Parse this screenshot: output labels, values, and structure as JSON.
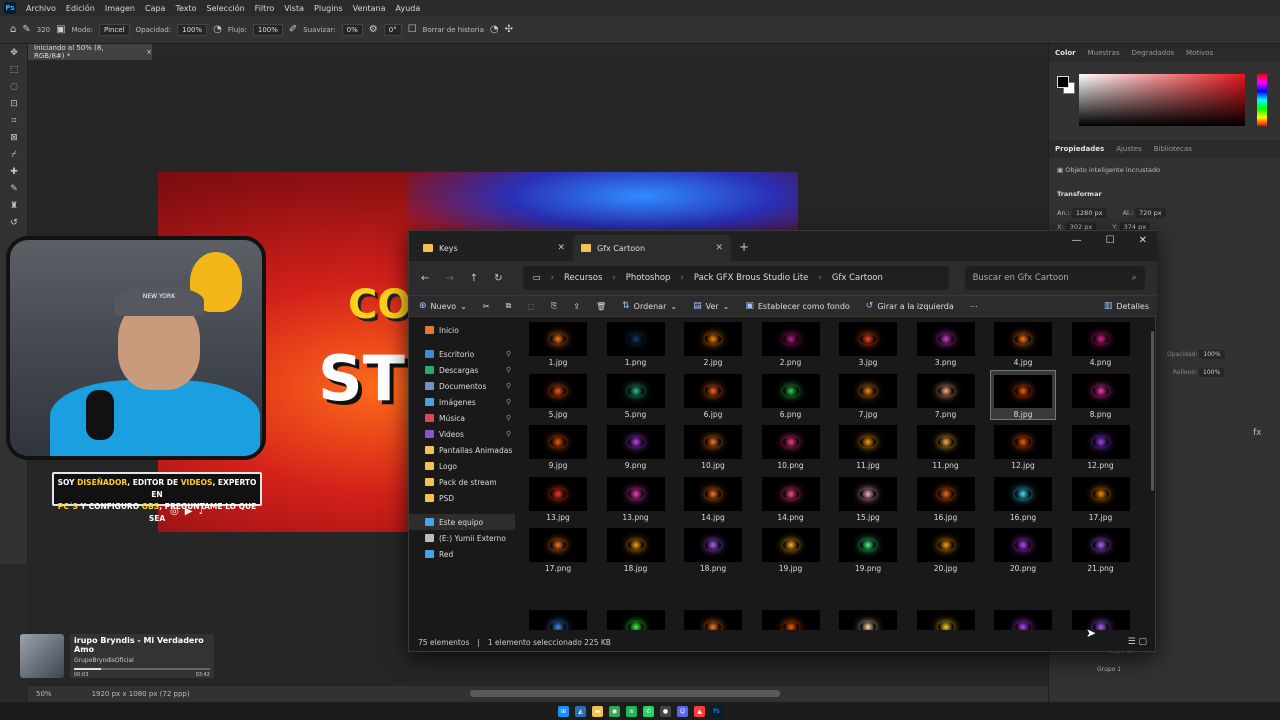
{
  "menu": {
    "items": [
      "Archivo",
      "Edición",
      "Imagen",
      "Capa",
      "Texto",
      "Selección",
      "Filtro",
      "Vista",
      "Plugins",
      "Ventana",
      "Ayuda"
    ]
  },
  "options": {
    "brush_size": "320",
    "mode_label": "Modo:",
    "mode_value": "Pincel",
    "opacity_label": "Opacidad:",
    "opacity_value": "100%",
    "flow_label": "Flujo:",
    "flow_value": "100%",
    "smooth_label": "Suavizar:",
    "smooth_value": "0%",
    "angle_value": "0°",
    "history_label": "Borrar de historia"
  },
  "document": {
    "tab_title": "Iniciando al 50% (8, RGB/8#) *",
    "zoom": "50%",
    "info": "1920 px x 1080 px (72 ppp)"
  },
  "artwork": {
    "text_top": "CO",
    "text_main": "ST"
  },
  "overlay": {
    "caption_line1a": "SOY ",
    "caption_line1b": "DISEÑADOR",
    "caption_line1c": ", EDITOR DE ",
    "caption_line1d": "VIDEOS",
    "caption_line1e": ", EXPERTO EN",
    "caption_line2a": "PC´S",
    "caption_line2b": " Y CONFIGURO ",
    "caption_line2c": "OBS",
    "caption_line2d": ", PREGUNTAME LO QUE SEA",
    "cap_text": "NEW YORK"
  },
  "music": {
    "title": "irupo Bryndis - Mi Verdadero Amo",
    "artist": "GrupoBryndisOficial",
    "time_current": "00:03",
    "time_total": "03:42",
    "progress": 0.2
  },
  "panel": {
    "tabs": [
      "Color",
      "Muestras",
      "Degradados",
      "Motivos"
    ],
    "props_tabs": [
      "Propiedades",
      "Ajustes",
      "Bibliotecas"
    ],
    "smart_object": "Objeto inteligente incrustado",
    "transform": "Transformar",
    "w_label": "An.:",
    "w_value": "1280 px",
    "h_label": "Al.:",
    "h_value": "720 px",
    "x_label": "X:",
    "x_value": "302 px",
    "y_label": "Y:",
    "y_value": "374 px",
    "layers_opacity": "Opacidad:",
    "layers_opacity_val": "100%",
    "layers_fill": "Relleno:",
    "layers_fill_val": "100%",
    "layer_capa": "Capa 12",
    "layer_group": "Grupo 1",
    "fx_label": "fx"
  },
  "explorer": {
    "tabs": [
      {
        "label": "Keys"
      },
      {
        "label": "Gfx Cartoon"
      }
    ],
    "breadcrumb": [
      "Recursos",
      "Photoshop",
      "Pack GFX Brous Studio Lite",
      "Gfx Cartoon"
    ],
    "search_placeholder": "Buscar en Gfx Cartoon",
    "commands": {
      "new": "Nuevo",
      "sort": "Ordenar",
      "view": "Ver",
      "set_bg": "Establecer como fondo",
      "rotate": "Girar a la izquierda",
      "details": "Detalles"
    },
    "nav": [
      {
        "label": "Inicio",
        "color": "#e07a3a",
        "pin": false
      },
      {
        "label": "Escritorio",
        "color": "#3d8bd9",
        "pin": true
      },
      {
        "label": "Descargas",
        "color": "#2fa86b",
        "pin": true
      },
      {
        "label": "Documentos",
        "color": "#6d93c9",
        "pin": true
      },
      {
        "label": "Imágenes",
        "color": "#4aa3e0",
        "pin": true
      },
      {
        "label": "Música",
        "color": "#d9495a",
        "pin": true
      },
      {
        "label": "Videos",
        "color": "#8a54c9",
        "pin": true
      },
      {
        "label": "Pantallas Animadas",
        "color": "#f2c14e",
        "pin": false
      },
      {
        "label": "Logo",
        "color": "#f2c14e",
        "pin": false
      },
      {
        "label": "Pack de stream",
        "color": "#f2c14e",
        "pin": false
      },
      {
        "label": "PSD",
        "color": "#f2c14e",
        "pin": false
      },
      {
        "label": "Este equipo",
        "color": "#4aa3e0",
        "pin": false
      },
      {
        "label": "(E:) Yumii Externo",
        "color": "#bbbbbb",
        "pin": false
      },
      {
        "label": "Red",
        "color": "#4aa3e0",
        "pin": false
      }
    ],
    "files": [
      {
        "name": "1.jpg",
        "fx": "#ff7a1a"
      },
      {
        "name": "1.png",
        "fx": "#1a3a6a"
      },
      {
        "name": "2.jpg",
        "fx": "#ff8a00"
      },
      {
        "name": "2.png",
        "fx": "#c0208a"
      },
      {
        "name": "3.jpg",
        "fx": "#ff4a1a"
      },
      {
        "name": "3.png",
        "fx": "#d040d0"
      },
      {
        "name": "4.jpg",
        "fx": "#ff7a1a"
      },
      {
        "name": "4.png",
        "fx": "#e0208a"
      },
      {
        "name": "5.jpg",
        "fx": "#ff5a1a"
      },
      {
        "name": "5.png",
        "fx": "#30c090"
      },
      {
        "name": "6.jpg",
        "fx": "#ff6a10"
      },
      {
        "name": "6.png",
        "fx": "#30d050"
      },
      {
        "name": "7.jpg",
        "fx": "#ff8a1a"
      },
      {
        "name": "7.png",
        "fx": "#ffb080"
      },
      {
        "name": "8.jpg",
        "fx": "#ff5a00"
      },
      {
        "name": "8.png",
        "fx": "#ff3ab0"
      },
      {
        "name": "9.jpg",
        "fx": "#ff5a00"
      },
      {
        "name": "9.png",
        "fx": "#c040ff"
      },
      {
        "name": "10.jpg",
        "fx": "#ff7a1a"
      },
      {
        "name": "10.png",
        "fx": "#ff3a8a"
      },
      {
        "name": "11.jpg",
        "fx": "#ffa010"
      },
      {
        "name": "11.png",
        "fx": "#ffb040"
      },
      {
        "name": "12.jpg",
        "fx": "#ff5a00"
      },
      {
        "name": "12.png",
        "fx": "#a040ff"
      },
      {
        "name": "13.jpg",
        "fx": "#ff3a1a"
      },
      {
        "name": "13.png",
        "fx": "#ff40c0"
      },
      {
        "name": "14.jpg",
        "fx": "#ff7a1a"
      },
      {
        "name": "14.png",
        "fx": "#ff4a8a"
      },
      {
        "name": "15.jpg",
        "fx": "#ffb0c0"
      },
      {
        "name": "16.jpg",
        "fx": "#ff6a1a"
      },
      {
        "name": "16.png",
        "fx": "#40e0ff"
      },
      {
        "name": "17.jpg",
        "fx": "#ff8a00"
      },
      {
        "name": "17.png",
        "fx": "#ff7a1a"
      },
      {
        "name": "18.jpg",
        "fx": "#ffa010"
      },
      {
        "name": "18.png",
        "fx": "#b060ff"
      },
      {
        "name": "19.jpg",
        "fx": "#ffb020"
      },
      {
        "name": "19.png",
        "fx": "#40ff80"
      },
      {
        "name": "20.jpg",
        "fx": "#ffa010"
      },
      {
        "name": "20.png",
        "fx": "#c040ff"
      },
      {
        "name": "21.png",
        "fx": "#b060ff"
      },
      {
        "name": "",
        "fx": "#4090ff"
      },
      {
        "name": "",
        "fx": "#40ff40"
      },
      {
        "name": "",
        "fx": "#ff7a1a"
      },
      {
        "name": "",
        "fx": "#ff5a00"
      },
      {
        "name": "",
        "fx": "#ffe0a0"
      },
      {
        "name": "",
        "fx": "#ffd020"
      },
      {
        "name": "",
        "fx": "#c040ff"
      },
      {
        "name": "",
        "fx": "#b060ff"
      }
    ],
    "selected_index": 14,
    "status_count": "75 elementos",
    "status_selected": "1 elemento seleccionado  225 KB"
  },
  "taskbar": {
    "ps_label": "Ps"
  }
}
